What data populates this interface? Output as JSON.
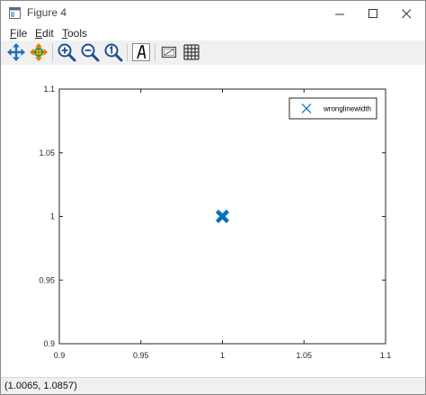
{
  "window": {
    "title": "Figure 4"
  },
  "menu": {
    "file": {
      "underline": "F",
      "rest": "ile"
    },
    "edit": {
      "underline": "E",
      "rest": "dit"
    },
    "tools": {
      "underline": "T",
      "rest": "ools"
    }
  },
  "toolbar": {
    "icons": [
      "pan-icon",
      "rotate-icon",
      "zoom-in-icon",
      "zoom-out-icon",
      "zoom-reset-icon",
      "insert-text-icon",
      "axes-box-icon",
      "grid-icon"
    ]
  },
  "status": {
    "coordinates": "(1.0065, 1.0857)"
  },
  "colors": {
    "marker": "#0072bd",
    "toolbar_bg": "#f0f0f0"
  },
  "chart_data": {
    "type": "scatter",
    "x": [
      1
    ],
    "y": [
      1
    ],
    "marker": "x",
    "series": [
      {
        "name": "wronglinewidth",
        "x": [
          1
        ],
        "y": [
          1
        ]
      }
    ],
    "xlim": [
      0.9,
      1.1
    ],
    "ylim": [
      0.9,
      1.1
    ],
    "xticks": [
      0.9,
      0.95,
      1,
      1.05,
      1.1
    ],
    "yticks": [
      0.9,
      0.95,
      1,
      1.05,
      1.1
    ],
    "xtick_labels": [
      "0.9",
      "0.95",
      "1",
      "1.05",
      "1.1"
    ],
    "ytick_labels": [
      "0.9",
      "0.95",
      "1",
      "1.05",
      "1.1"
    ],
    "legend_location": "top-right",
    "grid": false,
    "title": "",
    "xlabel": "",
    "ylabel": ""
  }
}
